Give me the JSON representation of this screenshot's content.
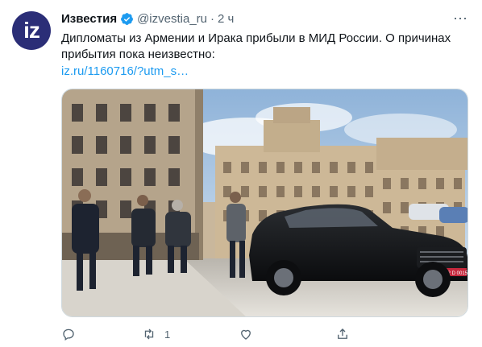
{
  "tweet": {
    "avatar_text": "iz",
    "author_name": "Известия",
    "handle": "@izvestia_ru",
    "separator": "·",
    "time": "2 ч",
    "text": "Дипломаты из Армении и Ирака прибыли в МИД России. О причинах прибытия пока неизвестно:",
    "link": "iz.ru/1160716/?utm_s…",
    "more_glyph": "⋯",
    "retweet_count": "1",
    "brand_color": "#2b2e77",
    "link_color": "#1d9bf0",
    "verified_color": "#1d9bf0",
    "car_plate": "002 D 0015"
  }
}
